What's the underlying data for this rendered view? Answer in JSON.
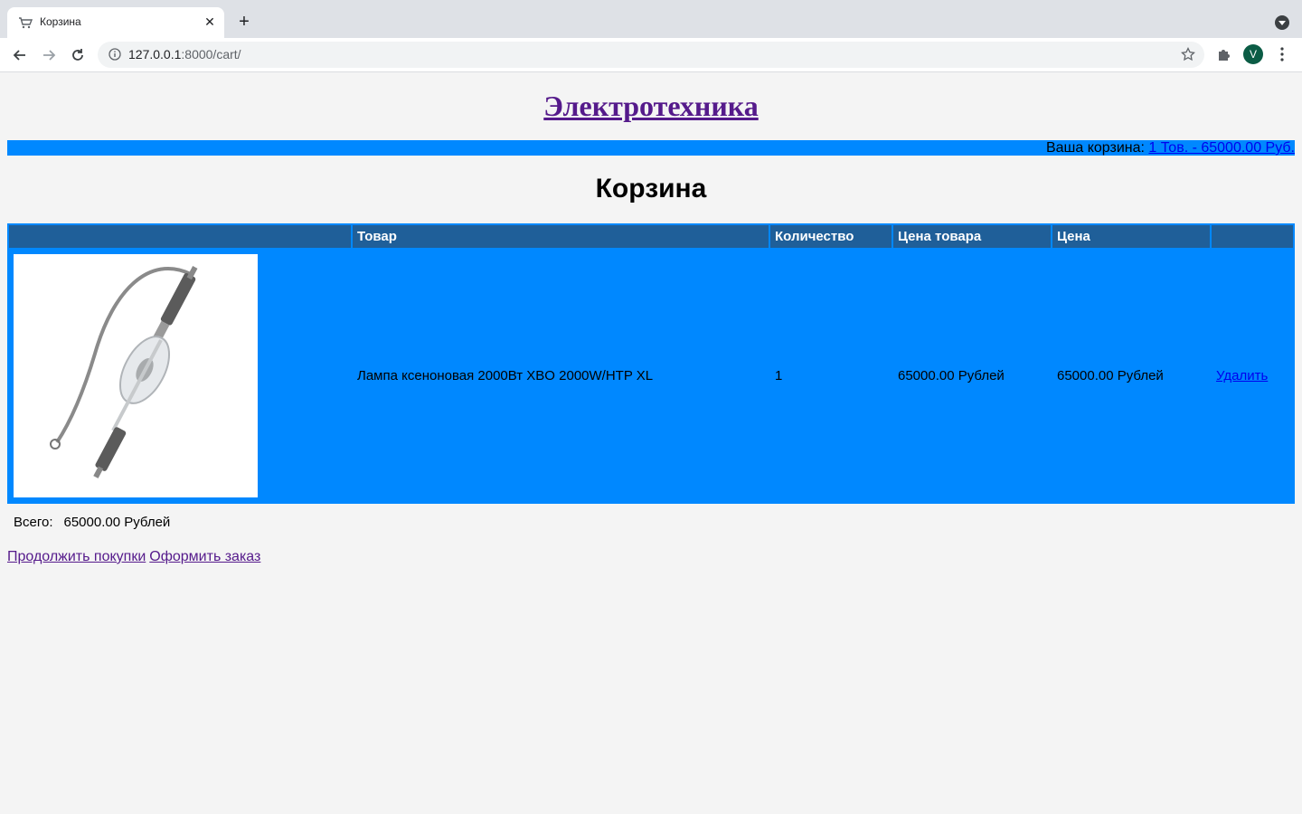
{
  "browser": {
    "tab_title": "Корзина",
    "tab_close": "✕",
    "new_tab": "+",
    "url_host": "127.0.0.1",
    "url_rest": ":8000/cart/",
    "profile_initial": "V"
  },
  "site": {
    "title": "Электротехника"
  },
  "cart_summary": {
    "label": "Ваша корзина: ",
    "link": "1 Тов. - 65000.00 Руб."
  },
  "page": {
    "heading": "Корзина"
  },
  "table": {
    "columns": [
      "",
      "Товар",
      "Количество",
      "Цена товара",
      "Цена",
      ""
    ],
    "rows": [
      {
        "product": "Лампа ксеноновая 2000Вт XBO 2000W/HTP XL",
        "quantity": "1",
        "unit_price": "65000.00 Рублей",
        "price": "65000.00 Рублей",
        "remove": "Удалить"
      }
    ]
  },
  "total": {
    "label": "Всего:",
    "value": "65000.00 Рублей"
  },
  "actions": {
    "continue": "Продолжить покупки",
    "checkout": "Оформить заказ"
  },
  "colors": {
    "accent": "#0088ff",
    "header": "#1f5f99",
    "visited_link": "#551a8b",
    "link": "#0000ee"
  }
}
